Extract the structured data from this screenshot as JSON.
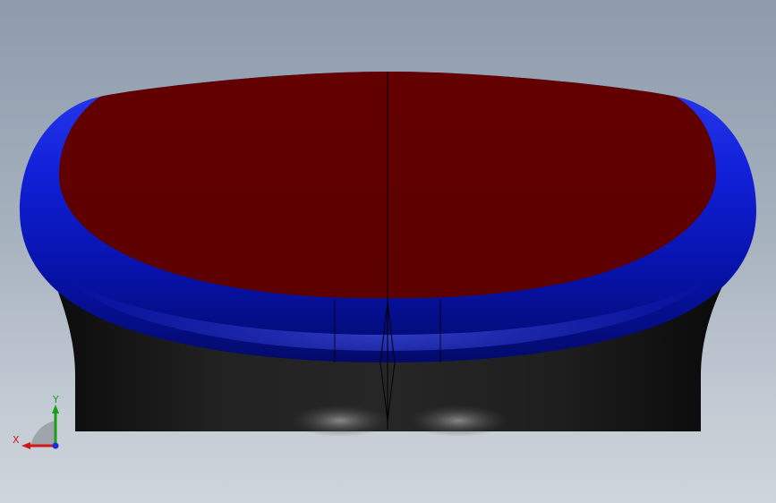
{
  "viewport": {
    "background_top": "#8d9bab",
    "background_bottom": "#cfd5dc"
  },
  "model": {
    "parts": [
      {
        "name": "seat-top-surface",
        "color": "#600000"
      },
      {
        "name": "seat-rim",
        "color": "#0a14b4"
      },
      {
        "name": "seat-base",
        "color": "#1a1a1a"
      }
    ]
  },
  "triad": {
    "x_label": "X",
    "y_label": "Y",
    "x_color": "#d01818",
    "y_color": "#18a018",
    "z_color": "#1830d8"
  }
}
